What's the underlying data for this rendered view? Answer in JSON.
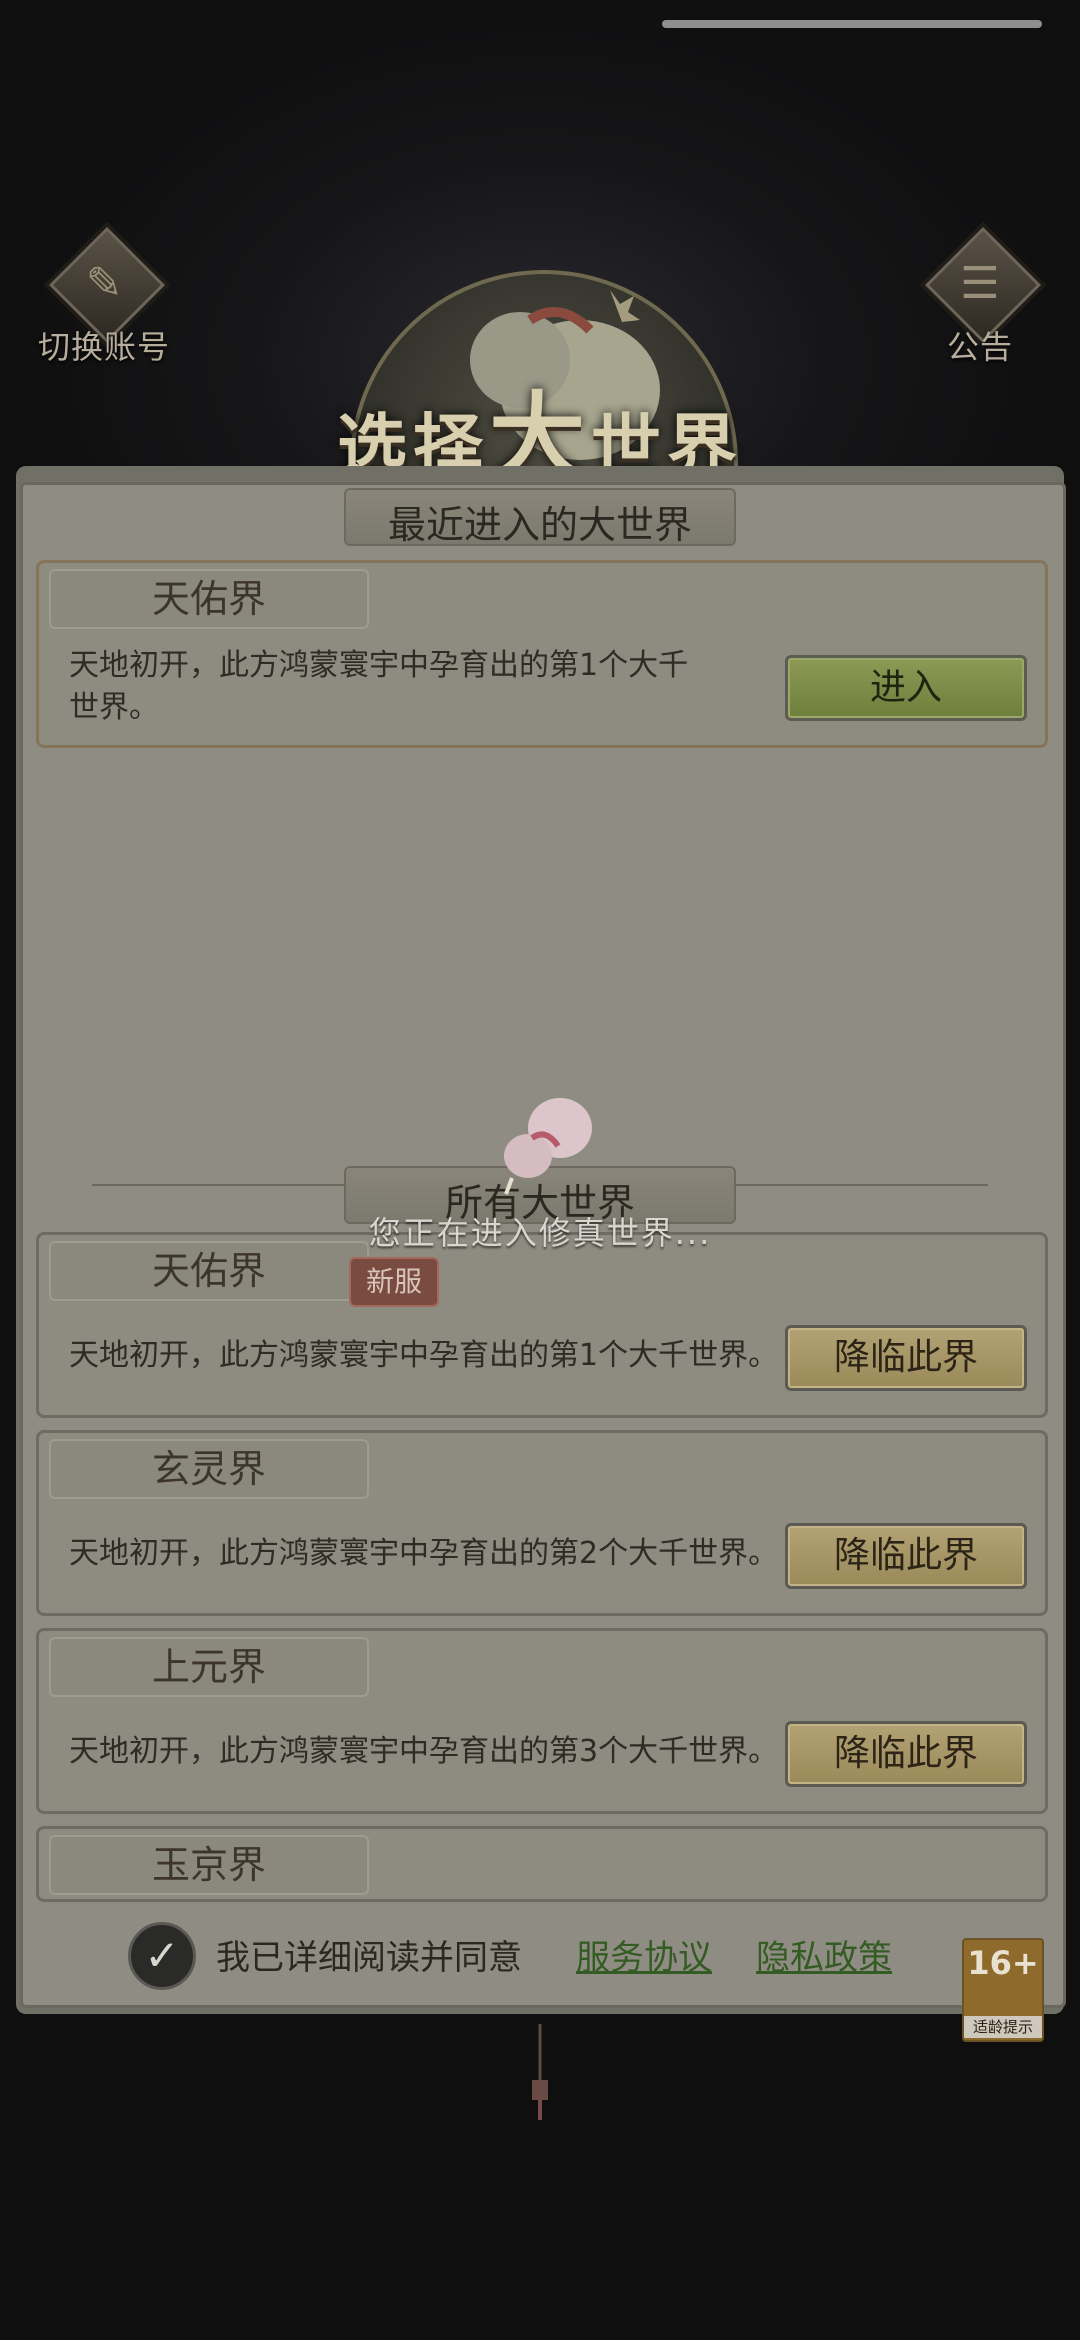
{
  "header": {
    "switch_account": "切换账号",
    "notice": "公告",
    "title_chars": [
      "选",
      "择",
      "大",
      "世",
      "界"
    ]
  },
  "recent": {
    "section_title": "最近进入的大世界",
    "server": {
      "name": "天佑界",
      "desc_line1": "天地初开，此方鸿蒙寰宇中孕育出的第1个大千",
      "desc_line2": "世界。",
      "button": "进入"
    }
  },
  "all": {
    "section_title": "所有大世界",
    "servers": [
      {
        "name": "天佑界",
        "badge": "新服",
        "desc": "天地初开，此方鸿蒙寰宇中孕育出的第1个大千世界。",
        "button": "降临此界"
      },
      {
        "name": "玄灵界",
        "badge": "",
        "desc": "天地初开，此方鸿蒙寰宇中孕育出的第2个大千世界。",
        "button": "降临此界"
      },
      {
        "name": "上元界",
        "badge": "",
        "desc": "天地初开，此方鸿蒙寰宇中孕育出的第3个大千世界。",
        "button": "降临此界"
      },
      {
        "name": "玉京界",
        "badge": "",
        "desc": "",
        "button": ""
      }
    ]
  },
  "loading": {
    "text": "您正在进入修真世界..."
  },
  "agreement": {
    "check_glyph": "✓",
    "text": "我已详细阅读并同意",
    "service_link": "服务协议",
    "privacy_link": "隐私政策"
  },
  "age_rating": {
    "value": "16+",
    "label": "适龄提示"
  },
  "icons": {
    "switch_account": "scroll-icon",
    "notice": "notice-scroll-icon"
  }
}
